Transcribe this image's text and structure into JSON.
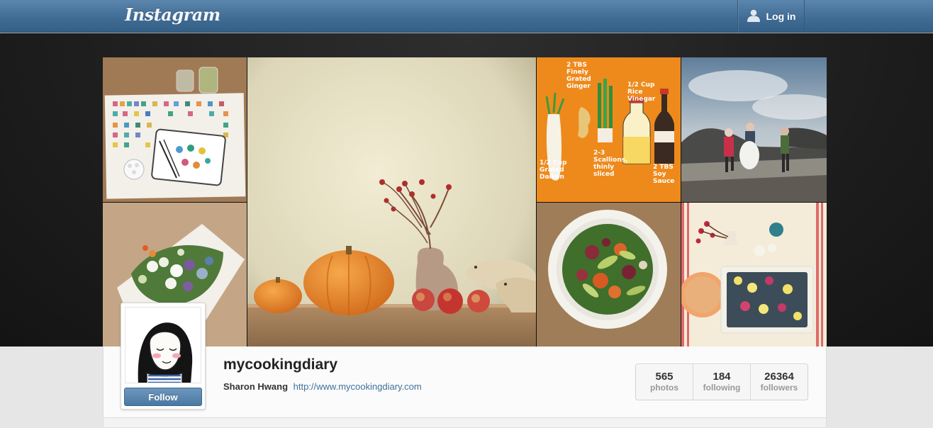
{
  "nav": {
    "logo": "Instagram",
    "login_label": "Log in",
    "login_icon": "user-icon"
  },
  "collage": {
    "tiles": [
      "watercolor-painting-photo",
      "pumpkin-still-life-photo",
      "ginger-recipe-illustration-photo",
      "beach-people-photo",
      "flower-bouquet-photo",
      "salad-bowl-photo",
      "table-setting-photo"
    ],
    "recipe_text": {
      "a": "2 TBS",
      "b": "Finely",
      "c": "Grated",
      "d": "Ginger",
      "e": "1/2 Cup",
      "f": "Rice",
      "g": "Vinegar",
      "h": "1/2 Cup",
      "i": "Grated",
      "j": "Daikon",
      "k": "2-3",
      "l": "Scallions,",
      "m": "thinly",
      "n": "sliced",
      "o": "2 TBS",
      "p": "Soy",
      "q": "Sauce"
    }
  },
  "profile": {
    "username": "mycookingdiary",
    "full_name": "Sharon Hwang",
    "website": "http://www.mycookingdiary.com",
    "follow_label": "Follow"
  },
  "stats": [
    {
      "value": "565",
      "label": "photos"
    },
    {
      "value": "184",
      "label": "following"
    },
    {
      "value": "26364",
      "label": "followers"
    }
  ],
  "colors": {
    "nav_blue": "#3e6b94",
    "link_blue": "#3f729b"
  }
}
